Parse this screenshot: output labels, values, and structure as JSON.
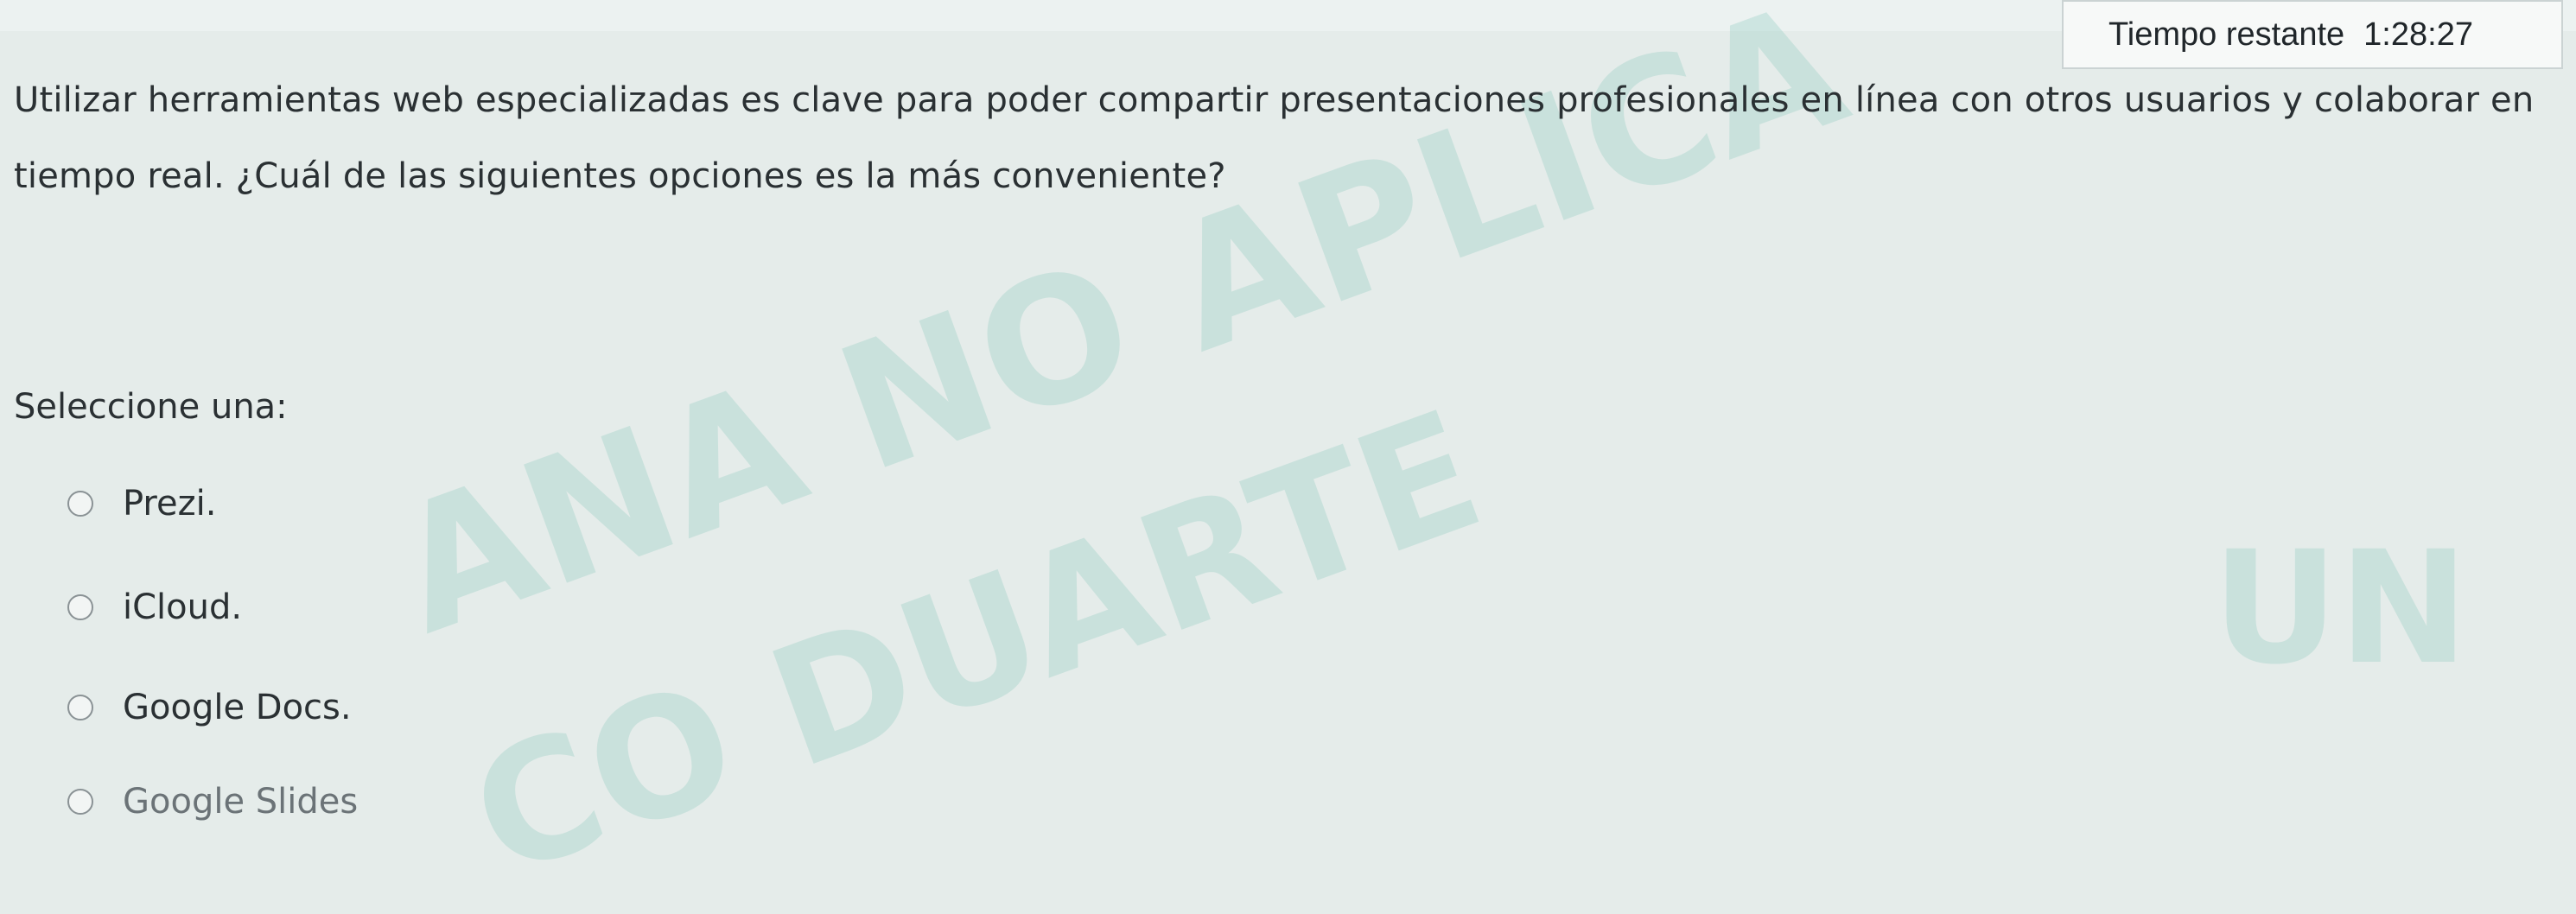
{
  "timer": {
    "label": "Tiempo restante",
    "value": "1:28:27"
  },
  "question": {
    "text": "Utilizar herramientas web especializadas es clave para poder compartir presentaciones profesionales en línea con otros usuarios y colaborar en tiempo real. ¿Cuál de las siguientes opciones es la más conveniente?"
  },
  "prompt": "Seleccione una:",
  "options": [
    {
      "label": "Prezi.",
      "selected": false
    },
    {
      "label": "iCloud.",
      "selected": false
    },
    {
      "label": "Google Docs.",
      "selected": false
    },
    {
      "label": "Google Slides",
      "selected": false
    }
  ],
  "watermark": {
    "line1": "ANA NO APLICA",
    "line2": "CO DUARTE",
    "corner": "UN"
  },
  "colors": {
    "background": "#e5ecea",
    "text": "#2a3033",
    "watermark": "#96cdc3"
  }
}
